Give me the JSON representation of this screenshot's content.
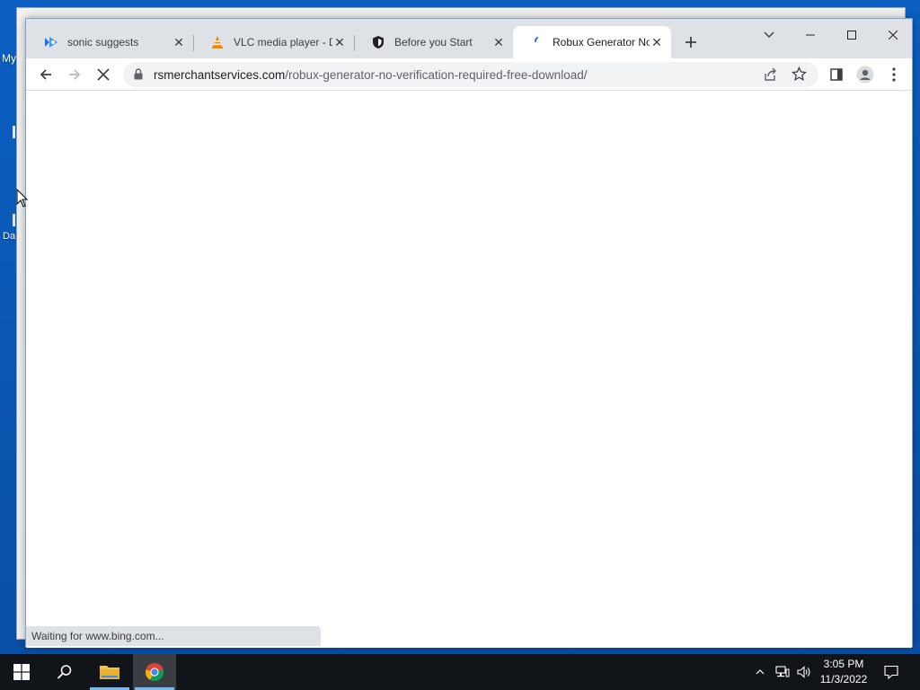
{
  "desktop": {
    "label_1": "My",
    "label_2": "Da"
  },
  "browser": {
    "tabs": [
      {
        "title": "sonic suggests",
        "icon": "sonic-favicon",
        "active": false
      },
      {
        "title": "VLC media player - D",
        "icon": "vlc-cone-favicon",
        "active": false
      },
      {
        "title": "Before you Start",
        "icon": "shield-favicon",
        "active": false
      },
      {
        "title": "Robux Generator No",
        "icon": "loading-spinner-favicon",
        "active": true
      }
    ],
    "address": {
      "domain": "rsmerchantservices.com",
      "path": "/robux-generator-no-verification-required-free-download/"
    },
    "status_text": "Waiting for www.bing.com..."
  },
  "taskbar": {
    "time": "3:05 PM",
    "date": "11/3/2022"
  },
  "colors": {
    "tabstrip": "#dee1e6",
    "desktop": "#0a5bb8",
    "taskbar": "#111418"
  }
}
